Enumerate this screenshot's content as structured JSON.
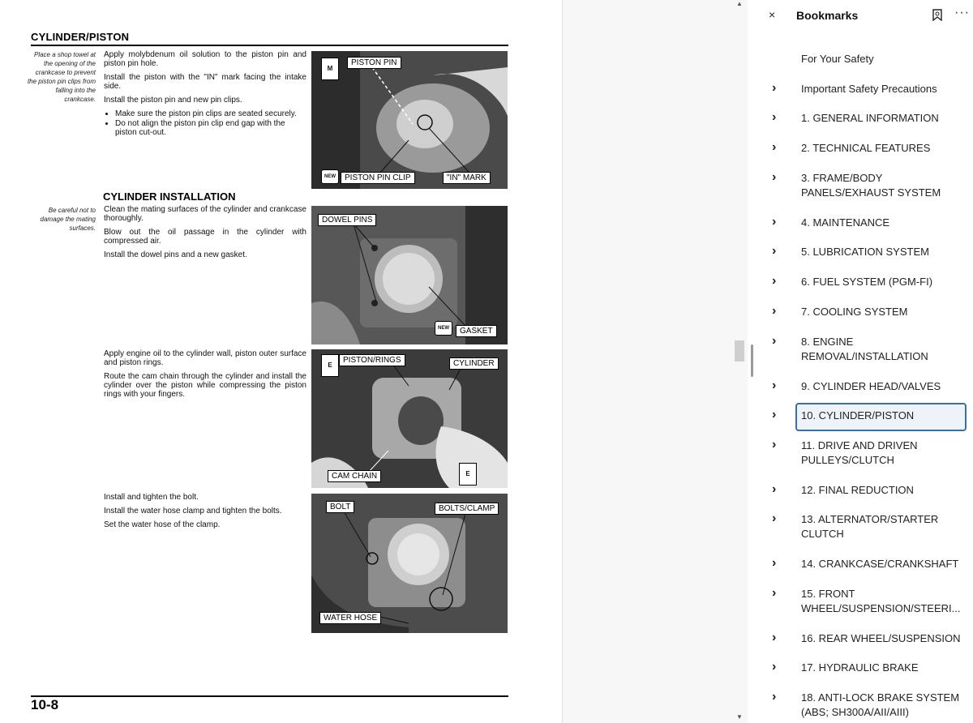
{
  "page": {
    "section_title": "CYLINDER/PISTON",
    "page_number": "10-8",
    "margin_notes": [
      "Place a shop towel at the opening of the crankcase to prevent the piston pin clips from falling into the crankcase.",
      "Be careful not to damage the mating surfaces."
    ],
    "steps_block1": {
      "p1": "Apply molybdenum oil solution to the piston pin and piston pin hole.",
      "p2": "Install the piston with the \"IN\" mark facing the intake side.",
      "p3": "Install the piston pin and new pin clips.",
      "bullet1": "Make sure the piston pin clips are seated securely.",
      "bullet2": "Do not align the piston pin clip end gap with the piston cut-out."
    },
    "sub_heading": "CYLINDER INSTALLATION",
    "steps_block2": {
      "p1": "Clean the mating surfaces of the cylinder and crankcase thoroughly.",
      "p2": "Blow out the oil passage in the cylinder with compressed air.",
      "p3": "Install the dowel pins and a new gasket."
    },
    "steps_block3": {
      "p1": "Apply engine oil to the cylinder wall, piston outer surface and piston rings.",
      "p2": "Route the cam chain through the cylinder and install the cylinder over the piston while compressing the piston rings with your fingers."
    },
    "steps_block4": {
      "p1": "Install and tighten the bolt.",
      "p2": "Install the water hose clamp and tighten the bolts.",
      "p3": "Set the water hose of the clamp."
    },
    "photo1": {
      "piston_pin": "PISTON PIN",
      "piston_pin_clip": "PISTON PIN CLIP",
      "in_mark": "\"IN\" MARK"
    },
    "photo2": {
      "dowel_pins": "DOWEL PINS",
      "gasket": "GASKET"
    },
    "photo3": {
      "piston_rings": "PISTON/RINGS",
      "cylinder": "CYLINDER",
      "cam_chain": "CAM CHAIN"
    },
    "photo4": {
      "bolt": "BOLT",
      "bolts_clamp": "BOLTS/CLAMP",
      "water_hose": "WATER HOSE"
    },
    "icon_new": "NEW"
  },
  "bookmarks": {
    "close_glyph": "×",
    "title": "Bookmarks",
    "more_glyph": "···",
    "chevron_glyph": "›",
    "selected_index": 10,
    "items": [
      {
        "label": "For Your Safety",
        "expandable": false
      },
      {
        "label": "Important Safety Precautions",
        "expandable": true
      },
      {
        "label": "1. GENERAL INFORMATION",
        "expandable": true
      },
      {
        "label": "2. TECHNICAL FEATURES",
        "expandable": true
      },
      {
        "label": "3. FRAME/BODY PANELS/EXHAUST SYSTEM",
        "expandable": true
      },
      {
        "label": "4. MAINTENANCE",
        "expandable": true
      },
      {
        "label": "5. LUBRICATION SYSTEM",
        "expandable": true
      },
      {
        "label": "6. FUEL SYSTEM (PGM-FI)",
        "expandable": true
      },
      {
        "label": "7. COOLING SYSTEM",
        "expandable": true
      },
      {
        "label": "8. ENGINE REMOVAL/INSTALLATION",
        "expandable": true
      },
      {
        "label": "9. CYLINDER HEAD/VALVES",
        "expandable": true
      },
      {
        "label": "10. CYLINDER/PISTON",
        "expandable": true
      },
      {
        "label": "11. DRIVE AND DRIVEN PULLEYS/CLUTCH",
        "expandable": true
      },
      {
        "label": "12. FINAL REDUCTION",
        "expandable": true
      },
      {
        "label": "13. ALTERNATOR/STARTER CLUTCH",
        "expandable": true
      },
      {
        "label": "14. CRANKCASE/CRANKSHAFT",
        "expandable": true
      },
      {
        "label": "15. FRONT WHEEL/SUSPENSION/STEERI...",
        "expandable": true
      },
      {
        "label": "16. REAR WHEEL/SUSPENSION",
        "expandable": true
      },
      {
        "label": "17. HYDRAULIC BRAKE",
        "expandable": true
      },
      {
        "label": "18. ANTI-LOCK BRAKE SYSTEM (ABS; SH300A/AII/AIII)",
        "expandable": true
      }
    ]
  },
  "scrollbar": {
    "up_glyph": "▲",
    "down_glyph": "▼"
  }
}
